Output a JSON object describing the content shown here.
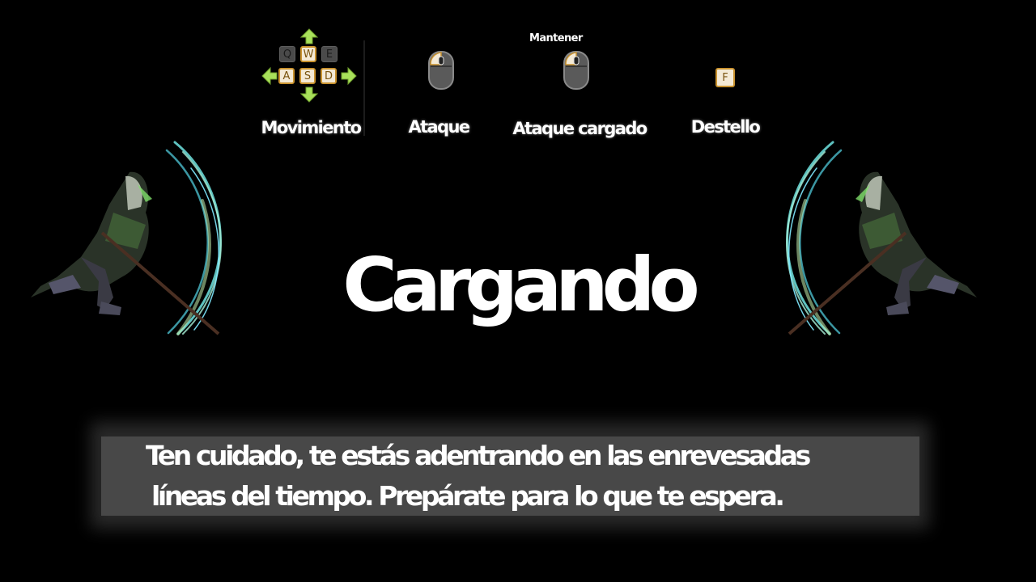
{
  "controls": {
    "movement": {
      "label": "Movimiento",
      "keys_top": [
        "Q",
        "W",
        "E"
      ],
      "keys_bottom": [
        "A",
        "S",
        "D"
      ],
      "arrow_icon": "green-direction-arrows-icon"
    },
    "attack": {
      "label": "Ataque",
      "icon": "mouse-left-click-icon"
    },
    "charged_attack": {
      "hold_label": "Mantener",
      "label": "Ataque cargado",
      "icon": "mouse-left-click-icon"
    },
    "flash": {
      "label": "Destello",
      "key": "F"
    }
  },
  "loading": {
    "title": "Cargando"
  },
  "tip": {
    "line1": "Ten cuidado, te estás adentrando en las enrevesadas",
    "line2": "líneas del tiempo. Prepárate para lo que te espera."
  },
  "colors": {
    "background": "#000000",
    "key_active_border": "#c9922e",
    "key_active_fill": "#f4ead6",
    "arrow_green": "#a8e05a",
    "tip_panel": "#484848",
    "slash_cyan": "#6fe3e0"
  },
  "decorations": {
    "left_character": "scythe-reaper-character",
    "right_character": "scythe-reaper-character"
  }
}
